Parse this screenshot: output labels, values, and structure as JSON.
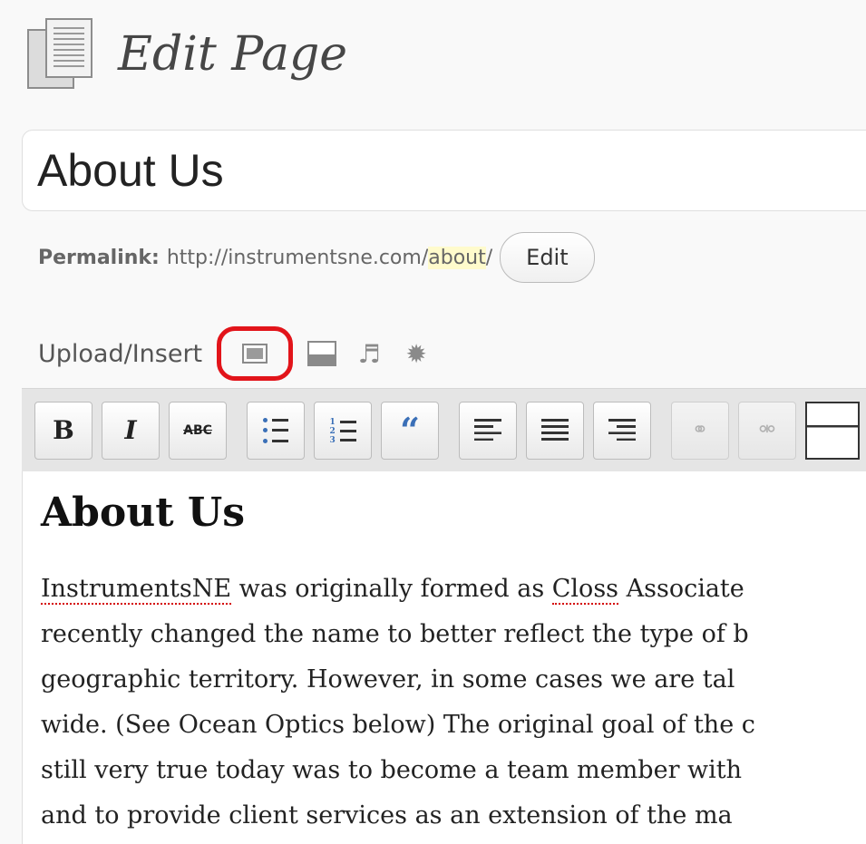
{
  "header": {
    "title": "Edit Page",
    "icon": "pages-icon"
  },
  "post": {
    "title": "About Us"
  },
  "permalink": {
    "label": "Permalink:",
    "base_url": "http://instrumentsne.com/",
    "slug": "about",
    "trailing": "/",
    "edit_label": "Edit"
  },
  "upload": {
    "label": "Upload/Insert",
    "icons": [
      "add-image-icon",
      "add-video-icon",
      "add-audio-icon",
      "add-media-icon"
    ],
    "highlight_color": "#e2141a"
  },
  "toolbar": {
    "bold_label": "B",
    "italic_label": "I",
    "strike_label": "ABC",
    "blockquote_label": "“",
    "buttons": [
      "bold",
      "italic",
      "strikethrough",
      "bulleted-list",
      "numbered-list",
      "blockquote",
      "align-left",
      "align-center",
      "align-right",
      "insert-link",
      "unlink",
      "insert-more"
    ]
  },
  "content": {
    "heading": "About Us",
    "lines": [
      {
        "pre": "",
        "spell1": "InstrumentsNE",
        "mid": " was originally formed as ",
        "spell2": "Closs",
        "post": " Associate"
      },
      {
        "text": "recently changed the name to better reflect the type of b"
      },
      {
        "text": "geographic territory. However, in some cases we are tal"
      },
      {
        "text": "wide. (See Ocean Optics below) The original goal of the c"
      },
      {
        "text": "still very true today was to become a team member with"
      },
      {
        "text": "and to provide client services as an extension of the ma"
      }
    ]
  }
}
